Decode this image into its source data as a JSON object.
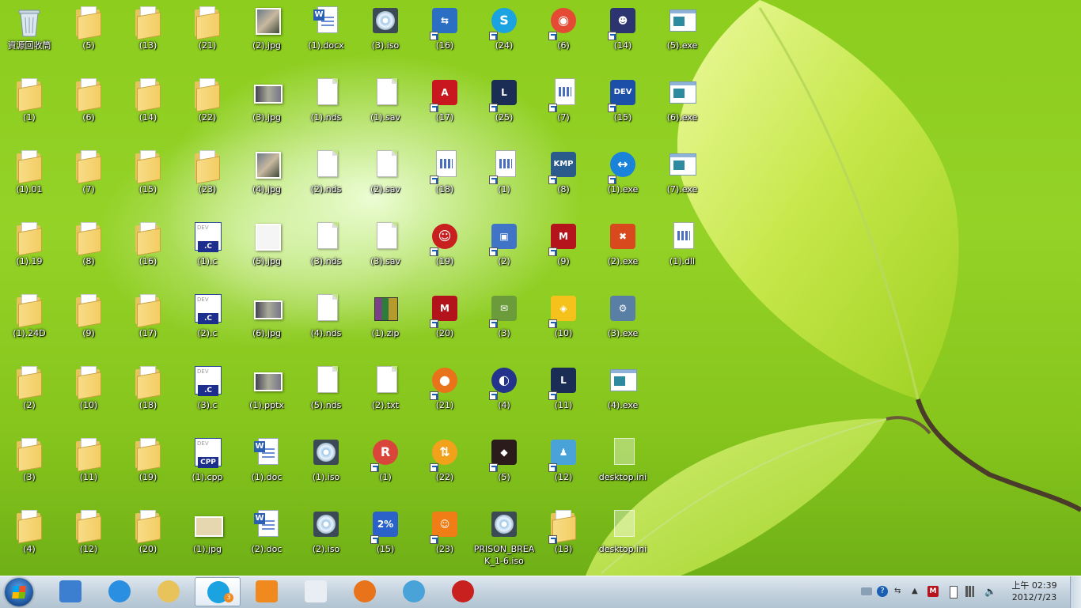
{
  "desktop": {
    "columns": [
      [
        {
          "label": "資源回收筒",
          "kind": "recycle",
          "shortcut": false
        },
        {
          "label": "(1)",
          "kind": "folder",
          "shortcut": false
        },
        {
          "label": "(1).01",
          "kind": "folder",
          "shortcut": false
        },
        {
          "label": "(1).19",
          "kind": "folder",
          "shortcut": false
        },
        {
          "label": "(1).24D",
          "kind": "folder",
          "shortcut": false
        },
        {
          "label": "(2)",
          "kind": "folder",
          "shortcut": false
        },
        {
          "label": "(3)",
          "kind": "folder",
          "shortcut": false
        },
        {
          "label": "(4)",
          "kind": "folder",
          "shortcut": false
        }
      ],
      [
        {
          "label": "(5)",
          "kind": "folder",
          "shortcut": false
        },
        {
          "label": "(6)",
          "kind": "folder",
          "shortcut": false
        },
        {
          "label": "(7)",
          "kind": "folder",
          "shortcut": false
        },
        {
          "label": "(8)",
          "kind": "folder",
          "shortcut": false
        },
        {
          "label": "(9)",
          "kind": "folder",
          "shortcut": false
        },
        {
          "label": "(10)",
          "kind": "folder",
          "shortcut": false
        },
        {
          "label": "(11)",
          "kind": "folder",
          "shortcut": false
        },
        {
          "label": "(12)",
          "kind": "folder",
          "shortcut": false
        }
      ],
      [
        {
          "label": "(13)",
          "kind": "folder",
          "shortcut": false
        },
        {
          "label": "(14)",
          "kind": "folder",
          "shortcut": false
        },
        {
          "label": "(15)",
          "kind": "folder",
          "shortcut": false
        },
        {
          "label": "(16)",
          "kind": "folder",
          "shortcut": false
        },
        {
          "label": "(17)",
          "kind": "folder",
          "shortcut": false
        },
        {
          "label": "(18)",
          "kind": "folder",
          "shortcut": false
        },
        {
          "label": "(19)",
          "kind": "folder",
          "shortcut": false
        },
        {
          "label": "(20)",
          "kind": "folder",
          "shortcut": false
        }
      ],
      [
        {
          "label": "(21)",
          "kind": "folder",
          "shortcut": false
        },
        {
          "label": "(22)",
          "kind": "folder",
          "shortcut": false
        },
        {
          "label": "(23)",
          "kind": "folder",
          "shortcut": false
        },
        {
          "label": "(1).c",
          "kind": "devc",
          "shortcut": false
        },
        {
          "label": "(2).c",
          "kind": "devc",
          "shortcut": false
        },
        {
          "label": "(3).c",
          "kind": "devc",
          "shortcut": false
        },
        {
          "label": "(1).cpp",
          "kind": "devcpp",
          "shortcut": false
        },
        {
          "label": "(1).jpg",
          "kind": "img-tan",
          "shortcut": false
        }
      ],
      [
        {
          "label": "(2).jpg",
          "kind": "img",
          "shortcut": false
        },
        {
          "label": "(3).jpg",
          "kind": "img-wide",
          "shortcut": false
        },
        {
          "label": "(4).jpg",
          "kind": "img",
          "shortcut": false
        },
        {
          "label": "(5).jpg",
          "kind": "img-light",
          "shortcut": false
        },
        {
          "label": "(6).jpg",
          "kind": "img-wide",
          "shortcut": false
        },
        {
          "label": "(1).pptx",
          "kind": "img-wide",
          "shortcut": false
        },
        {
          "label": "(1).doc",
          "kind": "word",
          "shortcut": false
        },
        {
          "label": "(2).doc",
          "kind": "word",
          "shortcut": false
        }
      ],
      [
        {
          "label": "(1).docx",
          "kind": "word",
          "shortcut": false
        },
        {
          "label": "(1).nds",
          "kind": "doc",
          "shortcut": false
        },
        {
          "label": "(2).nds",
          "kind": "doc",
          "shortcut": false
        },
        {
          "label": "(3).nds",
          "kind": "doc",
          "shortcut": false
        },
        {
          "label": "(4).nds",
          "kind": "doc",
          "shortcut": false
        },
        {
          "label": "(5).nds",
          "kind": "doc",
          "shortcut": false
        },
        {
          "label": "(1).iso",
          "kind": "disc",
          "shortcut": false
        },
        {
          "label": "(2).iso",
          "kind": "disc",
          "shortcut": false
        }
      ],
      [
        {
          "label": "(3).iso",
          "kind": "disc",
          "shortcut": false
        },
        {
          "label": "(1).sav",
          "kind": "doc",
          "shortcut": false
        },
        {
          "label": "(2).sav",
          "kind": "doc",
          "shortcut": false
        },
        {
          "label": "(3).sav",
          "kind": "doc",
          "shortcut": false
        },
        {
          "label": "(1).zip",
          "kind": "zip",
          "shortcut": false
        },
        {
          "label": "(2).txt",
          "kind": "doc",
          "shortcut": false
        },
        {
          "label": "(1)",
          "kind": "round",
          "color": "#d9453a",
          "text": "R",
          "shortcut": true
        },
        {
          "label": "(15)",
          "kind": "tile",
          "color": "#2a62c9",
          "text": "2%",
          "shortcut": true
        }
      ],
      [
        {
          "label": "(16)",
          "kind": "tile",
          "color": "#2b6fc2",
          "text": "⇆",
          "shortcut": true
        },
        {
          "label": "(17)",
          "kind": "tile",
          "color": "#c8171e",
          "text": "A",
          "shortcut": true
        },
        {
          "label": "(18)",
          "kind": "app",
          "shortcut": true
        },
        {
          "label": "(19)",
          "kind": "round",
          "color": "#c81f1f",
          "text": "☺",
          "shortcut": true
        },
        {
          "label": "(20)",
          "kind": "tile",
          "color": "#b3141c",
          "text": "M",
          "shortcut": true
        },
        {
          "label": "(21)",
          "kind": "round",
          "color": "#e8731b",
          "text": "●",
          "shortcut": true
        },
        {
          "label": "(22)",
          "kind": "round",
          "color": "#f2a21a",
          "text": "⇅",
          "shortcut": true
        },
        {
          "label": "(23)",
          "kind": "tile",
          "color": "#f07d16",
          "text": "☺",
          "shortcut": true
        }
      ],
      [
        {
          "label": "(24)",
          "kind": "round",
          "color": "#1aa3e0",
          "text": "S",
          "shortcut": true
        },
        {
          "label": "(25)",
          "kind": "tile",
          "color": "#1b2d55",
          "text": "L",
          "shortcut": true
        },
        {
          "label": "(1)",
          "kind": "app",
          "shortcut": true
        },
        {
          "label": "(2)",
          "kind": "tile",
          "color": "#3f74c7",
          "text": "▣",
          "shortcut": true
        },
        {
          "label": "(3)",
          "kind": "tile",
          "color": "#6b9b3a",
          "text": "✉",
          "shortcut": true
        },
        {
          "label": "(4)",
          "kind": "round",
          "color": "#24338c",
          "text": "◐",
          "shortcut": true
        },
        {
          "label": "(5)",
          "kind": "tile",
          "color": "#2b1b1b",
          "text": "◆",
          "shortcut": true
        },
        {
          "label": "PRISON_BREAK_1-6.iso",
          "kind": "disc",
          "shortcut": false
        }
      ],
      [
        {
          "label": "(6)",
          "kind": "round",
          "color": "#e54a35",
          "text": "◉",
          "shortcut": true
        },
        {
          "label": "(7)",
          "kind": "app",
          "shortcut": true
        },
        {
          "label": "(8)",
          "kind": "tile",
          "color": "#2a5b8a",
          "text": "KMP",
          "shortcut": true
        },
        {
          "label": "(9)",
          "kind": "tile",
          "color": "#b5141c",
          "text": "M",
          "shortcut": true
        },
        {
          "label": "(10)",
          "kind": "tile",
          "color": "#f5c21b",
          "text": "◈",
          "shortcut": true
        },
        {
          "label": "(11)",
          "kind": "tile",
          "color": "#1b2d55",
          "text": "L",
          "shortcut": true
        },
        {
          "label": "(12)",
          "kind": "tile",
          "color": "#4aa3d8",
          "text": "♟",
          "shortcut": true
        },
        {
          "label": "(13)",
          "kind": "folder",
          "shortcut": true
        }
      ],
      [
        {
          "label": "(14)",
          "kind": "tile",
          "color": "#2c3570",
          "text": "☻",
          "shortcut": true
        },
        {
          "label": "(15)",
          "kind": "tile",
          "color": "#1c4fa8",
          "text": "DEV",
          "shortcut": true
        },
        {
          "label": "(1).exe",
          "kind": "round",
          "color": "#1a83d9",
          "text": "↔",
          "shortcut": true
        },
        {
          "label": "(2).exe",
          "kind": "tile",
          "color": "#d84a1e",
          "text": "✖",
          "shortcut": false
        },
        {
          "label": "(3).exe",
          "kind": "tile",
          "color": "#5a7fa5",
          "text": "⚙",
          "shortcut": false
        },
        {
          "label": "(4).exe",
          "kind": "exe",
          "shortcut": false
        },
        {
          "label": "desktop.ini",
          "kind": "ghost",
          "shortcut": false
        },
        {
          "label": "desktop.ini",
          "kind": "ghost",
          "shortcut": false
        }
      ],
      [
        {
          "label": "(5).exe",
          "kind": "exe",
          "shortcut": false
        },
        {
          "label": "(6).exe",
          "kind": "exe",
          "shortcut": false
        },
        {
          "label": "(7).exe",
          "kind": "exe",
          "shortcut": false
        },
        {
          "label": "(1).dll",
          "kind": "app",
          "shortcut": false
        }
      ]
    ]
  },
  "taskbar": {
    "pinned": [
      {
        "name": "taskbar-app-1",
        "icon": "app-icon",
        "color": "#3c7fd0"
      },
      {
        "name": "taskbar-internet-explorer",
        "icon": "internet-explorer-icon",
        "color": "#2a8fe0"
      },
      {
        "name": "taskbar-explorer",
        "icon": "folder-icon",
        "color": "#e8c25a"
      },
      {
        "name": "taskbar-skype",
        "icon": "skype-icon",
        "color": "#1aa3e0",
        "active": true,
        "badge": "3"
      },
      {
        "name": "taskbar-media-player",
        "icon": "media-icon",
        "color": "#f08a1e"
      },
      {
        "name": "taskbar-notepad",
        "icon": "notepad-icon",
        "color": "#e9eef5"
      },
      {
        "name": "taskbar-firefox",
        "icon": "firefox-icon",
        "color": "#e8731b"
      },
      {
        "name": "taskbar-messenger",
        "icon": "messenger-icon",
        "color": "#4aa3d8"
      },
      {
        "name": "taskbar-app-red",
        "icon": "red-icon",
        "color": "#c81f1f"
      }
    ],
    "clock": {
      "time": "上午 02:39",
      "date": "2012/7/23"
    }
  }
}
